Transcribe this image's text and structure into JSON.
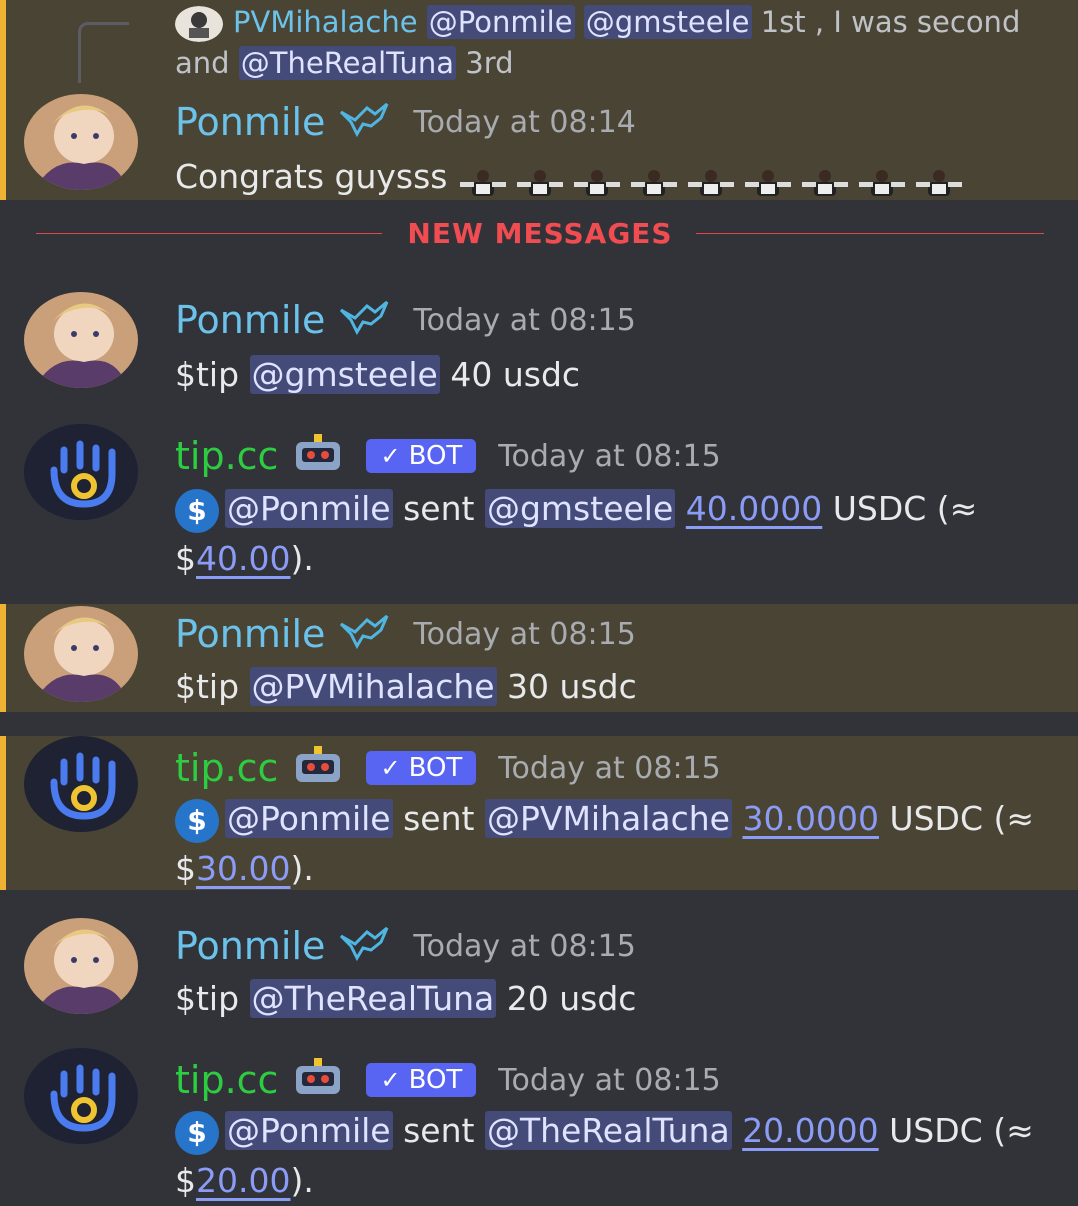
{
  "reply": {
    "author": "PVMihalache",
    "mention1": "@Ponmile",
    "mention2": "@gmsteele",
    "text1": " 1st , I was second and ",
    "mention3": "@TheRealTuna",
    "text2": " 3rd"
  },
  "messages": [
    {
      "author": "Ponmile",
      "time": "Today at 08:14",
      "text": "Congrats guysss",
      "emoji_count": 9
    },
    {
      "author": "Ponmile",
      "time": "Today at 08:15",
      "prefix": "$tip ",
      "mention": "@gmsteele",
      "suffix": " 40 usdc"
    },
    {
      "author": "tip.cc",
      "bot_label": "BOT",
      "time": "Today at 08:15",
      "coin": "$",
      "from": "@Ponmile",
      "sent": " sent ",
      "to": "@gmsteele",
      "amount": "40.0000",
      "unit": " USDC (≈ ",
      "dollar": "$",
      "usd": "40.00",
      "close": ")."
    },
    {
      "author": "Ponmile",
      "time": "Today at 08:15",
      "prefix": "$tip ",
      "mention": "@PVMihalache",
      "suffix": " 30 usdc"
    },
    {
      "author": "tip.cc",
      "bot_label": "BOT",
      "time": "Today at 08:15",
      "coin": "$",
      "from": "@Ponmile",
      "sent": " sent ",
      "to": "@PVMihalache",
      "amount": "30.0000",
      "unit": " USDC (≈ ",
      "dollar": "$",
      "usd": "30.00",
      "close": ")."
    },
    {
      "author": "Ponmile",
      "time": "Today at 08:15",
      "prefix": "$tip ",
      "mention": "@TheRealTuna",
      "suffix": " 20 usdc"
    },
    {
      "author": "tip.cc",
      "bot_label": "BOT",
      "time": "Today at 08:15",
      "coin": "$",
      "from": "@Ponmile",
      "sent": " sent ",
      "to": "@TheRealTuna",
      "amount": "20.0000",
      "unit": " USDC (≈ ",
      "dollar": "$",
      "usd": "20.00",
      "close": ")."
    }
  ],
  "divider": {
    "label": "NEW MESSAGES"
  },
  "colors": {
    "accent_highlight": "#f0b232",
    "mention_bg": "#444b78",
    "bot_badge": "#5865f2",
    "new_messages": "#f14c51",
    "user_name": "#6bc2ea",
    "bot_name": "#2ecc40"
  },
  "icons": {
    "user_badge": "bird-badge-icon",
    "bot_emoji": "robot-icon",
    "coin": "usdc-coin-icon"
  }
}
